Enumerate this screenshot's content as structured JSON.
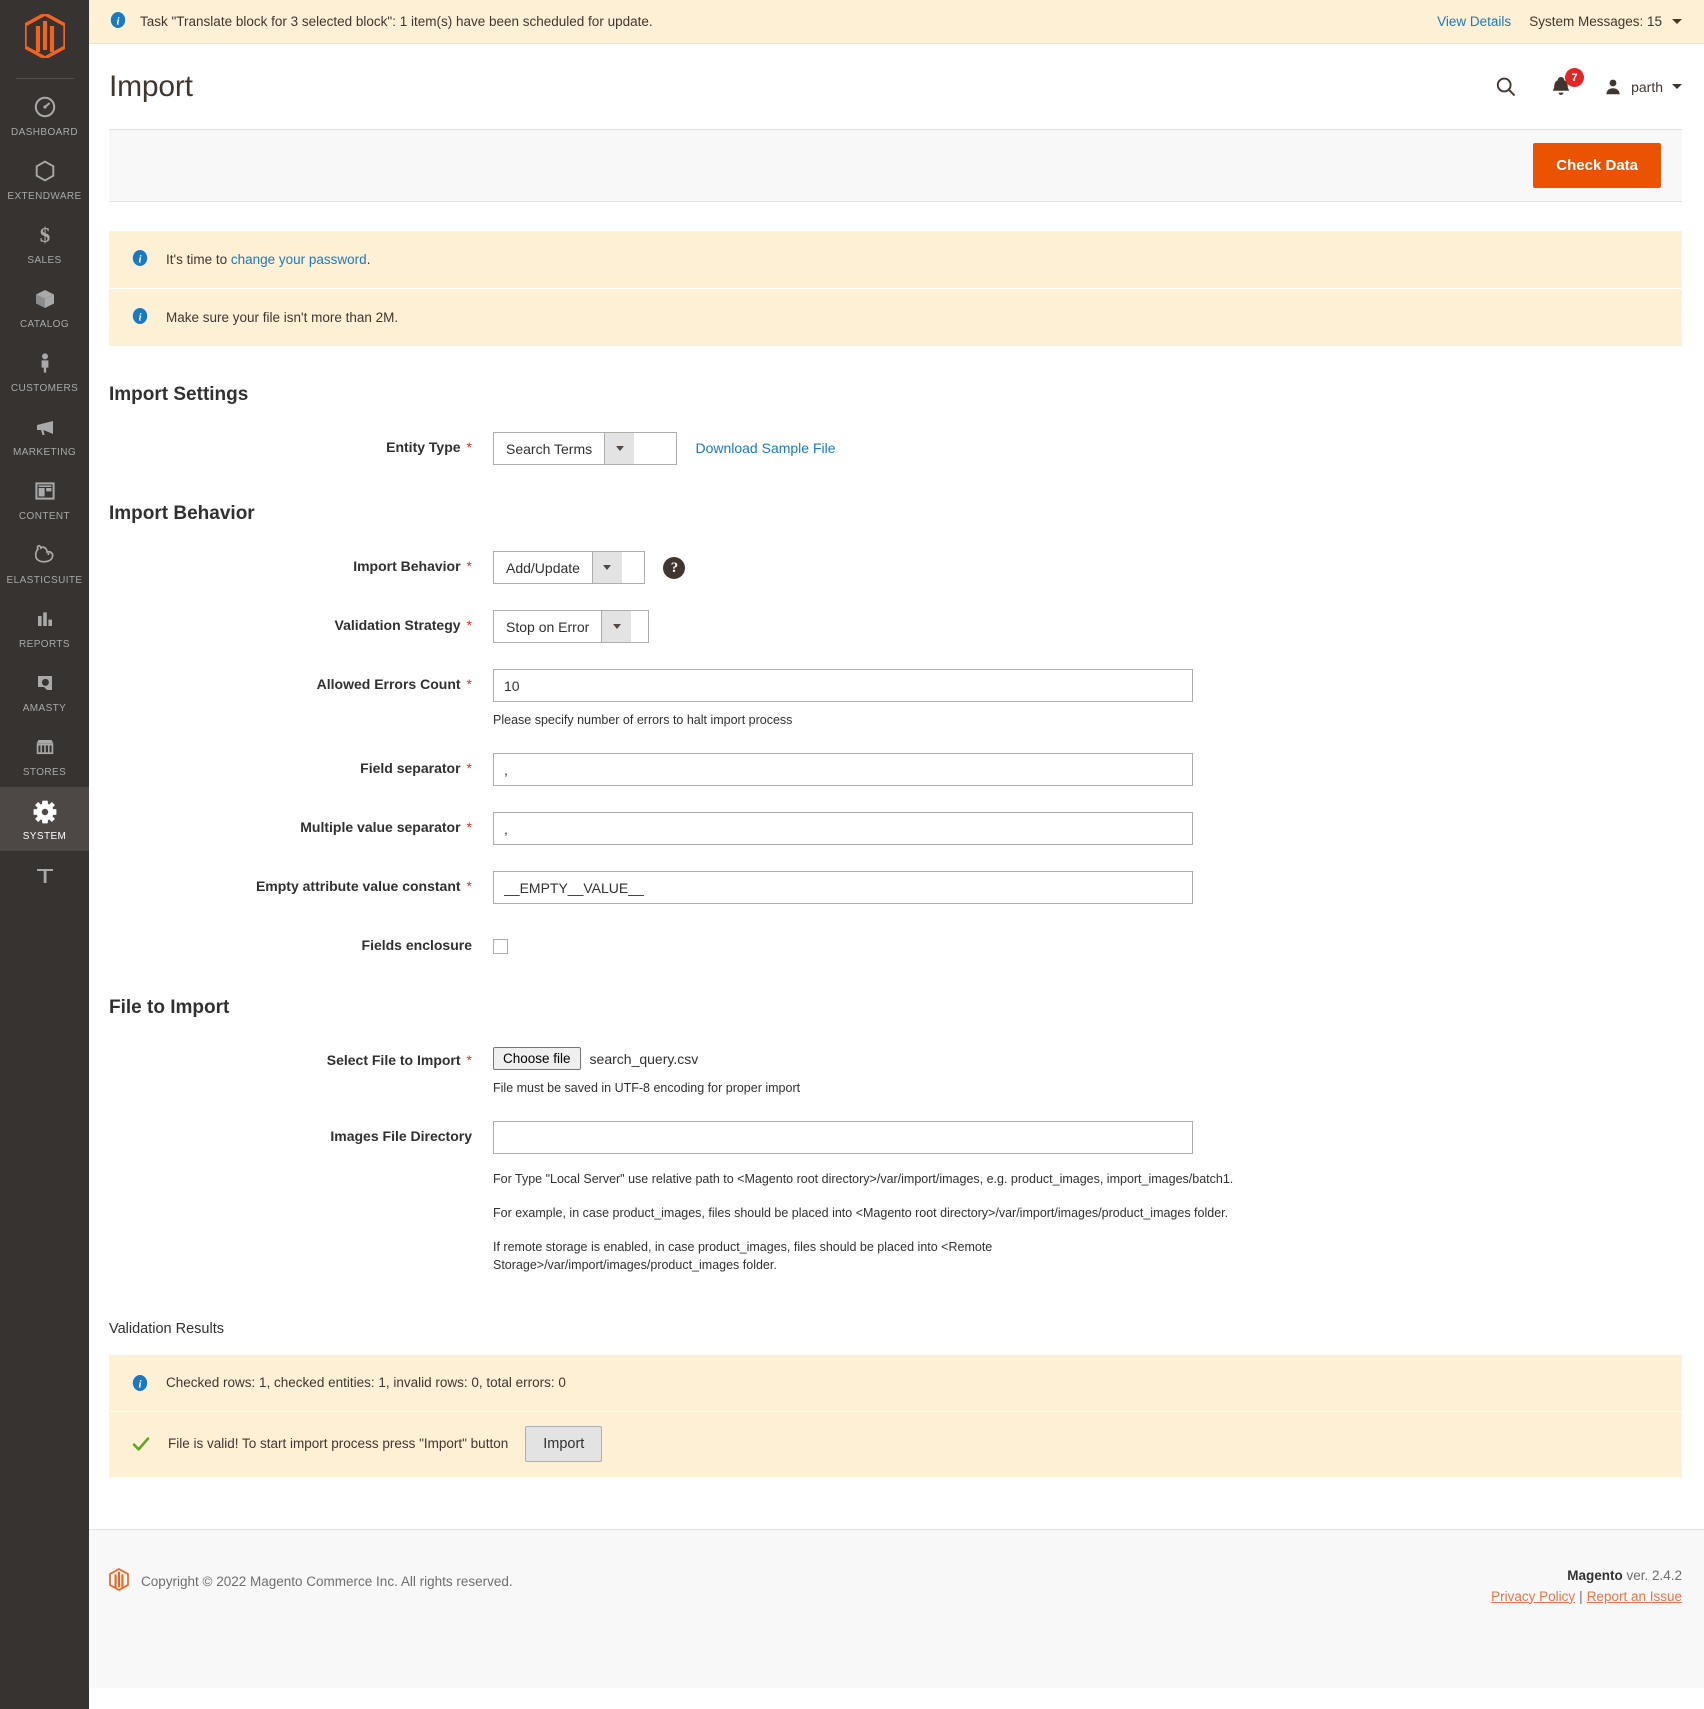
{
  "sidebar": {
    "logo_name": "magento-logo",
    "items": [
      {
        "label": "DASHBOARD",
        "icon": "gauge-icon",
        "active": false
      },
      {
        "label": "EXTENDWARE",
        "icon": "hexagon-icon",
        "active": false
      },
      {
        "label": "SALES",
        "icon": "dollar-icon",
        "active": false
      },
      {
        "label": "CATALOG",
        "icon": "box-icon",
        "active": false
      },
      {
        "label": "CUSTOMERS",
        "icon": "person-icon",
        "active": false
      },
      {
        "label": "MARKETING",
        "icon": "megaphone-icon",
        "active": false
      },
      {
        "label": "CONTENT",
        "icon": "layout-icon",
        "active": false
      },
      {
        "label": "ELASTICSUITE",
        "icon": "rabbit-icon",
        "active": false
      },
      {
        "label": "REPORTS",
        "icon": "bar-chart-icon",
        "active": false
      },
      {
        "label": "AMASTY",
        "icon": "amasty-icon",
        "active": false
      },
      {
        "label": "STORES",
        "icon": "storefront-icon",
        "active": false
      },
      {
        "label": "SYSTEM",
        "icon": "gear-icon",
        "active": true
      }
    ]
  },
  "system_message_bar": {
    "icon": "info-icon",
    "text": "Task \"Translate block for 3 selected block\": 1 item(s) have been scheduled for update.",
    "view_details_label": "View Details",
    "messages_label": "System Messages: 15"
  },
  "header": {
    "title": "Import",
    "search_icon": "search-icon",
    "notifications_icon": "bell-icon",
    "notifications_count": "7",
    "user_icon": "user-icon",
    "user_name": "parth"
  },
  "page_actions": {
    "check_data_label": "Check Data"
  },
  "notices": [
    {
      "icon": "info-icon",
      "text_before": "It's time to ",
      "link": "change your password",
      "text_after": "."
    },
    {
      "icon": "info-icon",
      "text_before": "Make sure your file isn't more than 2M.",
      "link": "",
      "text_after": ""
    }
  ],
  "import_settings": {
    "section_title": "Import Settings",
    "entity_type": {
      "label": "Entity Type",
      "required": "*",
      "value": "Search Terms",
      "download_sample_label": "Download Sample File"
    }
  },
  "import_behavior": {
    "section_title": "Import Behavior",
    "behavior": {
      "label": "Import Behavior",
      "required": "*",
      "value": "Add/Update",
      "help_icon": "question-icon",
      "help_glyph": "?"
    },
    "validation_strategy": {
      "label": "Validation Strategy",
      "required": "*",
      "value": "Stop on Error"
    },
    "allowed_errors": {
      "label": "Allowed Errors Count",
      "required": "*",
      "value": "10",
      "note": "Please specify number of errors to halt import process"
    },
    "field_separator": {
      "label": "Field separator",
      "required": "*",
      "value": ","
    },
    "multiple_value_separator": {
      "label": "Multiple value separator",
      "required": "*",
      "value": ","
    },
    "empty_attribute_value": {
      "label": "Empty attribute value constant",
      "required": "*",
      "value": "__EMPTY__VALUE__"
    },
    "fields_enclosure": {
      "label": "Fields enclosure",
      "checked": false
    }
  },
  "file_to_import": {
    "section_title": "File to Import",
    "select_file": {
      "label": "Select File to Import",
      "required": "*",
      "choose_button_label": "Choose file",
      "file_name": "search_query.csv",
      "note": "File must be saved in UTF-8 encoding for proper import"
    },
    "images_directory": {
      "label": "Images File Directory",
      "value": "",
      "placeholder": "",
      "note_1": "For Type \"Local Server\" use relative path to <Magento root directory>/var/import/images, e.g. product_images, import_images/batch1.",
      "note_2": "For example, in case product_images, files should be placed into <Magento root directory>/var/import/images/product_images folder.",
      "note_3": "If remote storage is enabled, in case product_images, files should be placed into <Remote Storage>/var/import/images/product_images folder."
    }
  },
  "validation_results": {
    "title": "Validation Results",
    "summary": {
      "icon": "info-icon",
      "text": "Checked rows: 1, checked entities: 1, invalid rows: 0, total errors: 0"
    },
    "valid": {
      "icon": "check-icon",
      "text": "File is valid! To start import process press \"Import\" button",
      "button_label": "Import"
    }
  },
  "footer": {
    "logo_icon": "magento-logo-icon",
    "copyright": "Copyright © 2022 Magento Commerce Inc. All rights reserved.",
    "version_brand": "Magento",
    "version_text": " ver. 2.4.2",
    "privacy_policy": "Privacy Policy",
    "separator": "|",
    "report_issue": "Report an Issue"
  }
}
